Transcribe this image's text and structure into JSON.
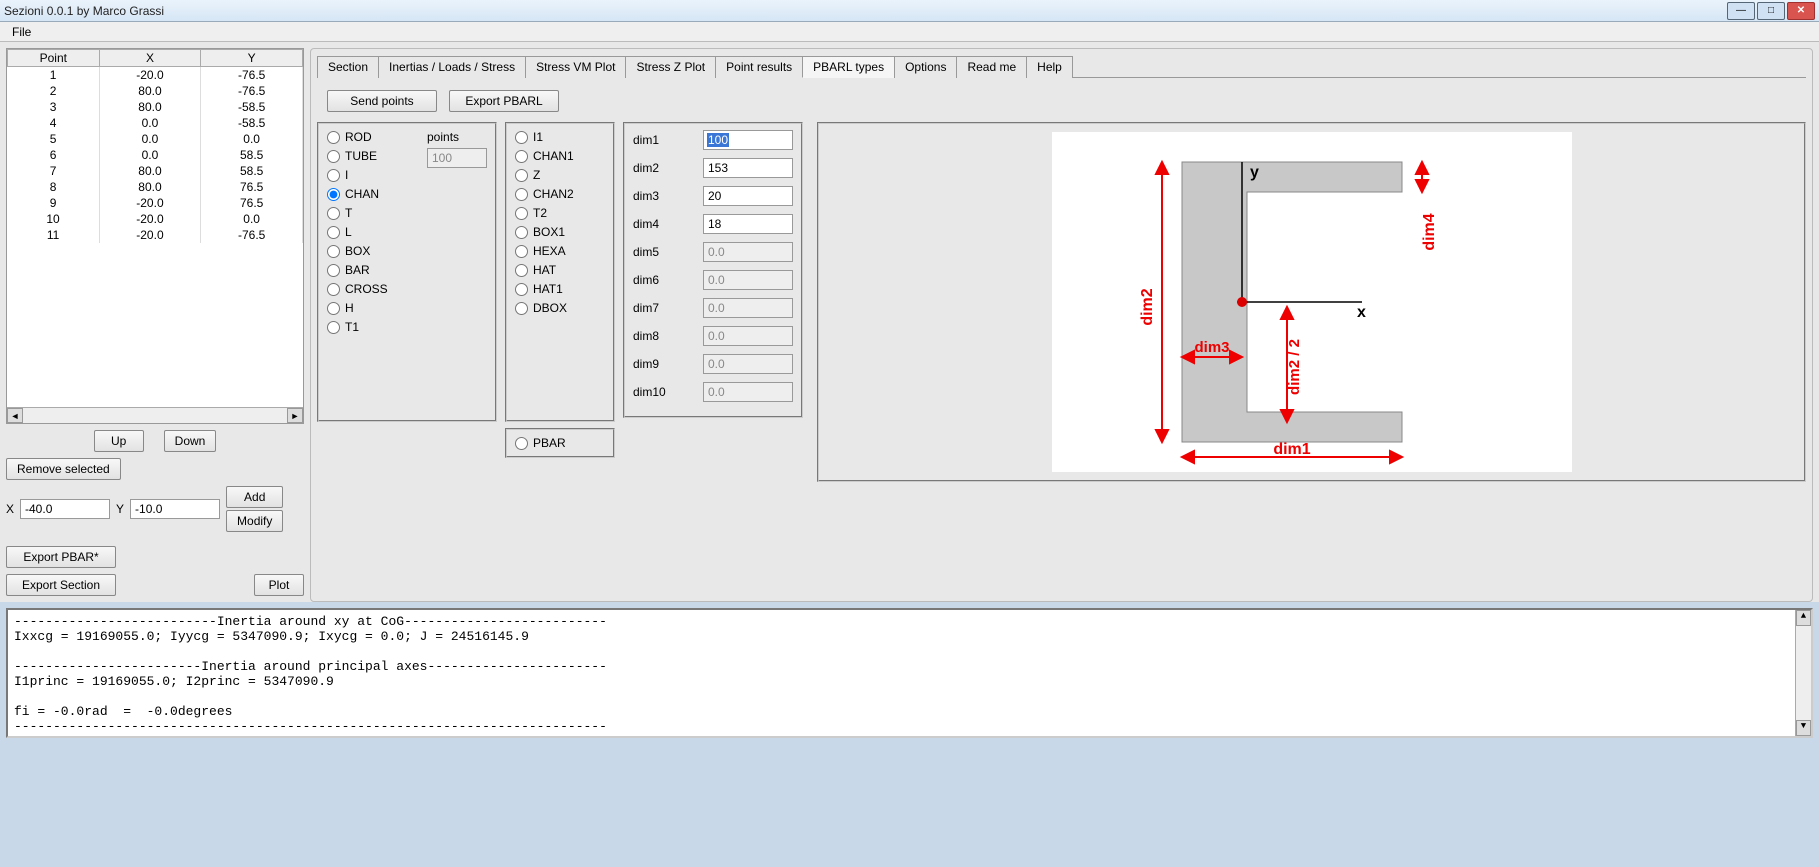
{
  "window": {
    "title": "Sezioni 0.0.1 by Marco Grassi"
  },
  "menu": {
    "file": "File"
  },
  "table": {
    "headers": {
      "point": "Point",
      "x": "X",
      "y": "Y"
    },
    "rows": [
      {
        "p": "1",
        "x": "-20.0",
        "y": "-76.5"
      },
      {
        "p": "2",
        "x": "80.0",
        "y": "-76.5"
      },
      {
        "p": "3",
        "x": "80.0",
        "y": "-58.5"
      },
      {
        "p": "4",
        "x": "0.0",
        "y": "-58.5"
      },
      {
        "p": "5",
        "x": "0.0",
        "y": "0.0"
      },
      {
        "p": "6",
        "x": "0.0",
        "y": "58.5"
      },
      {
        "p": "7",
        "x": "80.0",
        "y": "58.5"
      },
      {
        "p": "8",
        "x": "80.0",
        "y": "76.5"
      },
      {
        "p": "9",
        "x": "-20.0",
        "y": "76.5"
      },
      {
        "p": "10",
        "x": "-20.0",
        "y": "0.0"
      },
      {
        "p": "11",
        "x": "-20.0",
        "y": "-76.5"
      }
    ]
  },
  "left": {
    "up": "Up",
    "down": "Down",
    "remove": "Remove selected",
    "xlabel": "X",
    "xval": "-40.0",
    "ylabel": "Y",
    "yval": "-10.0",
    "add": "Add",
    "modify": "Modify",
    "export_pbar": "Export PBAR*",
    "export_section": "Export Section",
    "plot": "Plot"
  },
  "tabs": {
    "section": "Section",
    "inertias": "Inertias / Loads / Stress",
    "vm": "Stress VM Plot",
    "z": "Stress Z Plot",
    "pointres": "Point results",
    "pbarl": "PBARL types",
    "options": "Options",
    "readme": "Read me",
    "help": "Help"
  },
  "pbarl": {
    "send": "Send points",
    "export": "Export PBARL",
    "points_label": "points",
    "points_value": "100",
    "typesA": [
      "ROD",
      "TUBE",
      "I",
      "CHAN",
      "T",
      "L",
      "BOX",
      "BAR",
      "CROSS",
      "H",
      "T1"
    ],
    "typesB": [
      "I1",
      "CHAN1",
      "Z",
      "CHAN2",
      "T2",
      "BOX1",
      "HEXA",
      "HAT",
      "HAT1",
      "DBOX"
    ],
    "pbar": "PBAR",
    "selected": "CHAN",
    "dims": [
      {
        "label": "dim1",
        "value": "100",
        "enabled": true,
        "selected": true
      },
      {
        "label": "dim2",
        "value": "153",
        "enabled": true
      },
      {
        "label": "dim3",
        "value": "20",
        "enabled": true
      },
      {
        "label": "dim4",
        "value": "18",
        "enabled": true
      },
      {
        "label": "dim5",
        "value": "0.0",
        "enabled": false
      },
      {
        "label": "dim6",
        "value": "0.0",
        "enabled": false
      },
      {
        "label": "dim7",
        "value": "0.0",
        "enabled": false
      },
      {
        "label": "dim8",
        "value": "0.0",
        "enabled": false
      },
      {
        "label": "dim9",
        "value": "0.0",
        "enabled": false
      },
      {
        "label": "dim10",
        "value": "0.0",
        "enabled": false
      }
    ]
  },
  "diagram": {
    "y": "y",
    "x": "x",
    "dim1": "dim1",
    "dim2": "dim2",
    "dim3": "dim3",
    "dim4": "dim4",
    "dim22": "dim2 / 2"
  },
  "console": {
    "text": "--------------------------Inertia around xy at CoG--------------------------\nIxxcg = 19169055.0; Iyycg = 5347090.9; Ixycg = 0.0; J = 24516145.9\n\n------------------------Inertia around principal axes-----------------------\nI1princ = 19169055.0; I2princ = 5347090.9\n\nfi = -0.0rad  =  -0.0degrees\n----------------------------------------------------------------------------"
  }
}
